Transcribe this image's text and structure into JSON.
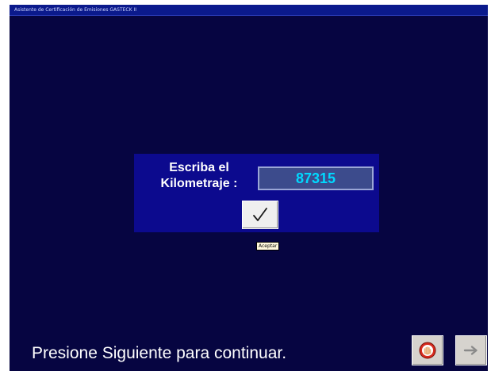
{
  "window": {
    "title": "Asistente de Certificación de Emisiones GASTECK II"
  },
  "dialog": {
    "prompt_line1": "Escriba el",
    "prompt_line2": "Kilometraje :",
    "km_value": "87315",
    "ok_button": {
      "icon": "checkmark-icon",
      "tooltip": "Aceptar"
    }
  },
  "footer": {
    "instruction": "Presione Siguiente para continuar.",
    "stop_button": {
      "icon": "stop-hand-icon"
    },
    "next_button": {
      "icon": "arrow-right-icon"
    }
  },
  "colors": {
    "background": "#060541",
    "panel": "#0c0a8e",
    "field_bg": "#3c4b8c",
    "field_text": "#00d9ff",
    "title_bar": "#0b1a8c"
  }
}
